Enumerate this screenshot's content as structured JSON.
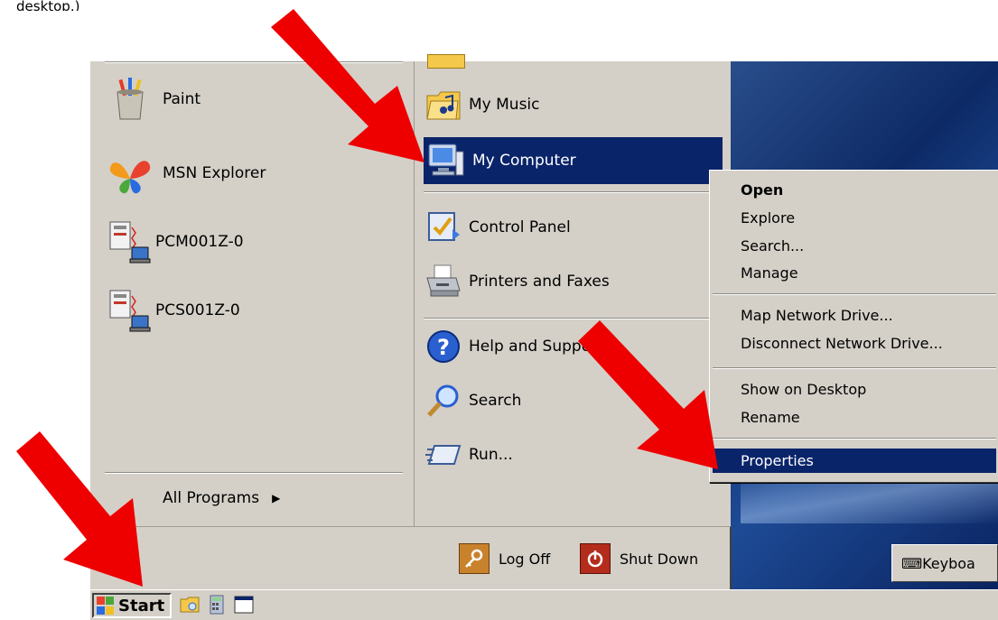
{
  "top_note": "desktop.)",
  "start_menu": {
    "left_items": [
      {
        "label": "Paint",
        "icon": "paint-icon"
      },
      {
        "label": "MSN Explorer",
        "icon": "msn-butterfly-icon"
      },
      {
        "label": "PCM001Z-0",
        "icon": "terminal-computer-icon"
      },
      {
        "label": "PCS001Z-0",
        "icon": "terminal-computer-icon"
      }
    ],
    "all_programs": "All Programs",
    "right_items": [
      {
        "label": "My Music",
        "icon": "music-folder-icon"
      },
      {
        "label": "My Computer",
        "icon": "computer-icon",
        "selected": true
      },
      {
        "label": "Control Panel",
        "icon": "control-panel-icon"
      },
      {
        "label": "Printers and Faxes",
        "icon": "printer-icon"
      },
      {
        "label": "Help and Support",
        "icon": "help-icon"
      },
      {
        "label": "Search",
        "icon": "search-icon"
      },
      {
        "label": "Run...",
        "icon": "run-icon"
      }
    ],
    "log_off": "Log Off",
    "shut_down": "Shut Down"
  },
  "context_menu": {
    "items": [
      {
        "label": "Open",
        "bold": true
      },
      {
        "label": "Explore"
      },
      {
        "label": "Search..."
      },
      {
        "label": "Manage"
      },
      {
        "label": "Map Network Drive..."
      },
      {
        "label": "Disconnect Network Drive..."
      },
      {
        "label": "Show on Desktop"
      },
      {
        "label": "Rename"
      },
      {
        "label": "Properties",
        "selected": true
      }
    ]
  },
  "taskbar": {
    "start_label": "Start",
    "keyboard_label": "Keyboa"
  },
  "colors": {
    "menu_bg": "#d4d0c8",
    "selection": "#0a246a",
    "arrow": "#ee0000"
  }
}
